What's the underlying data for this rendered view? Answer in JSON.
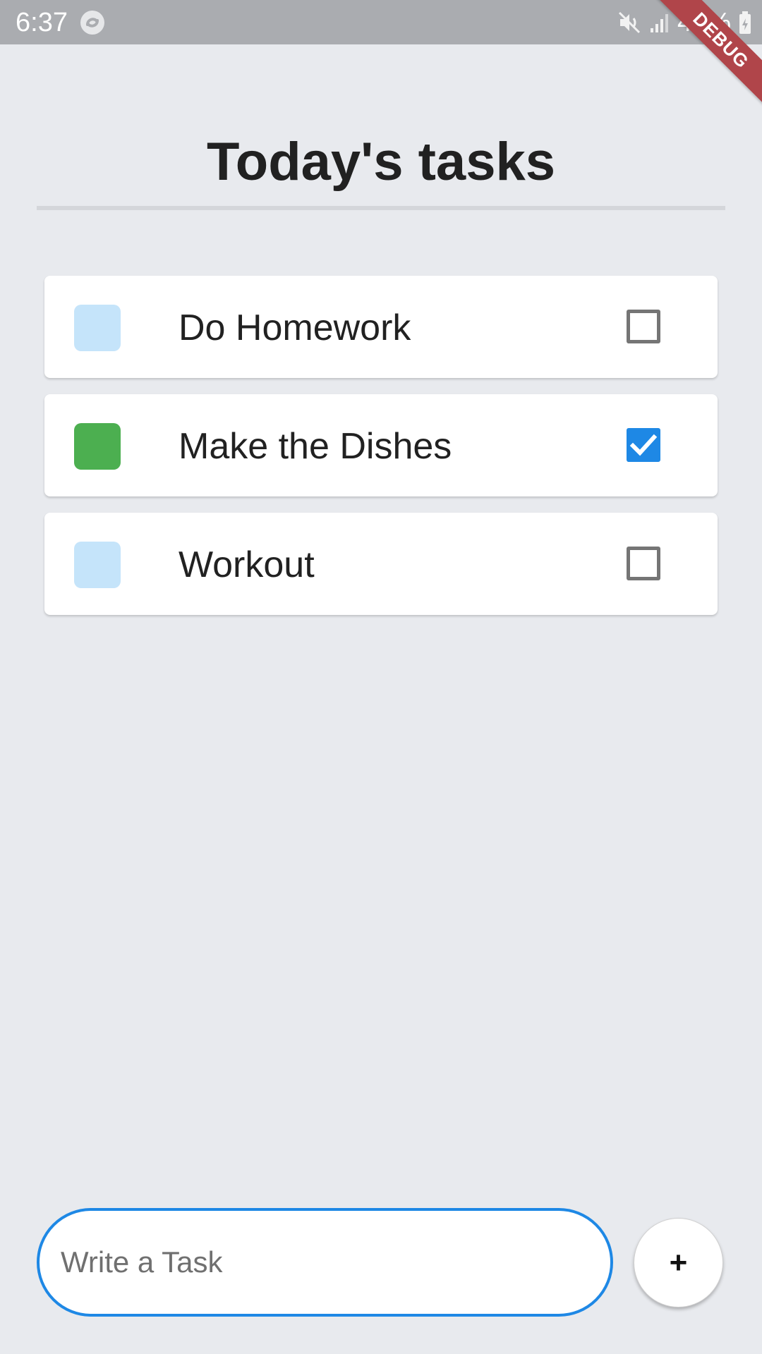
{
  "status_bar": {
    "time": "6:37",
    "battery_percent": "42%",
    "icons": [
      "app-notification-icon",
      "mute-icon",
      "signal-icon",
      "battery-charging-icon"
    ]
  },
  "debug_banner": {
    "label": "DEBUG"
  },
  "header": {
    "title": "Today's tasks"
  },
  "tasks": [
    {
      "label": "Do Homework",
      "color": "#C5E4FA",
      "checked": false
    },
    {
      "label": "Make the Dishes",
      "color": "#4CAF50",
      "checked": true
    },
    {
      "label": "Workout",
      "color": "#C5E4FA",
      "checked": false
    }
  ],
  "composer": {
    "placeholder": "Write a Task",
    "add_button_label": "+"
  },
  "colors": {
    "accent": "#1E88E5",
    "background": "#E8EAEE",
    "done": "#4CAF50",
    "pending": "#C5E4FA"
  }
}
